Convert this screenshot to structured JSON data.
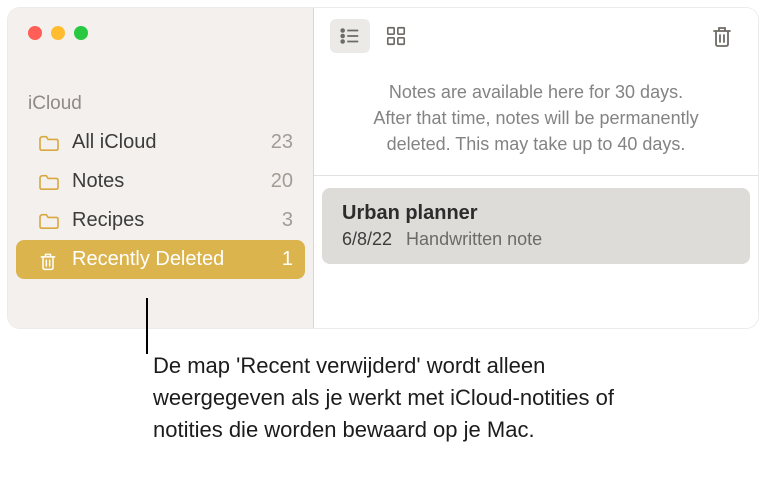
{
  "sidebar": {
    "section_label": "iCloud",
    "items": [
      {
        "label": "All iCloud",
        "count": "23",
        "icon": "folder"
      },
      {
        "label": "Notes",
        "count": "20",
        "icon": "folder"
      },
      {
        "label": "Recipes",
        "count": "3",
        "icon": "folder"
      },
      {
        "label": "Recently Deleted",
        "count": "1",
        "icon": "trash",
        "selected": true
      }
    ]
  },
  "banner": {
    "line1": "Notes are available here for 30 days.",
    "line2": "After that time, notes will be permanently",
    "line3": "deleted. This may take up to 40 days."
  },
  "notes": [
    {
      "title": "Urban planner",
      "date": "6/8/22",
      "subtitle": "Handwritten note"
    }
  ],
  "callout": {
    "text": "De map 'Recent verwijderd' wordt alleen weergegeven als je werkt met iCloud-notities of notities die worden bewaard op je Mac."
  }
}
